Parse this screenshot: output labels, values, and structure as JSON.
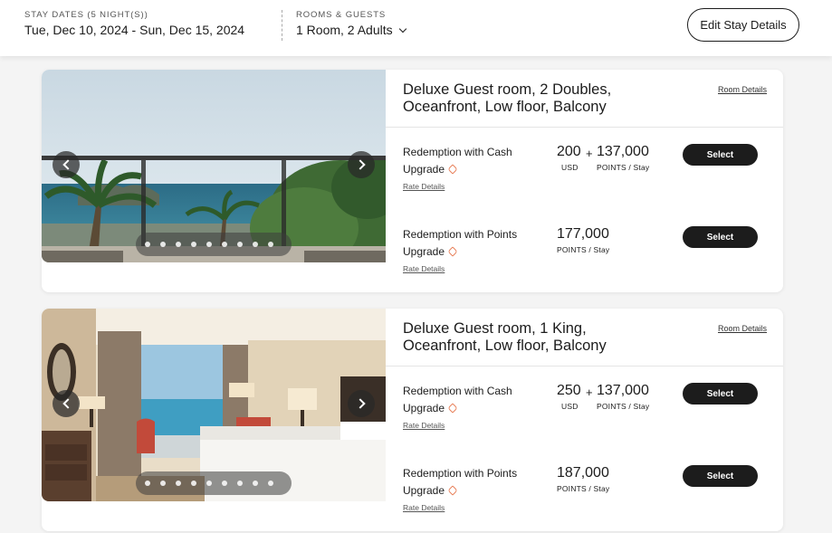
{
  "header": {
    "stay_label": "STAY DATES (5 NIGHT(S))",
    "stay_value": "Tue, Dec 10, 2024 - Sun, Dec 15, 2024",
    "rooms_label": "ROOMS & GUESTS",
    "rooms_value": "1 Room, 2 Adults",
    "edit_button": "Edit Stay Details"
  },
  "rooms": [
    {
      "title_line1": "Deluxe Guest room, 2 Doubles,",
      "title_line2": "Oceanfront, Low floor, Balcony",
      "details_link": "Room Details",
      "rates": [
        {
          "name": "Redemption with Cash",
          "upgrade": "Upgrade",
          "rate_link": "Rate Details",
          "cash": "200",
          "cash_unit": "USD",
          "plus": "+",
          "points": "137,000",
          "points_unit": "POINTS / Stay",
          "select": "Select"
        },
        {
          "name": "Redemption with Points",
          "upgrade": "Upgrade",
          "rate_link": "Rate Details",
          "points": "177,000",
          "points_unit": "POINTS / Stay",
          "select": "Select"
        }
      ]
    },
    {
      "title_line1": "Deluxe Guest room, 1 King,",
      "title_line2": "Oceanfront, Low floor, Balcony",
      "details_link": "Room Details",
      "rates": [
        {
          "name": "Redemption with Cash",
          "upgrade": "Upgrade",
          "rate_link": "Rate Details",
          "cash": "250",
          "cash_unit": "USD",
          "plus": "+",
          "points": "137,000",
          "points_unit": "POINTS / Stay",
          "select": "Select"
        },
        {
          "name": "Redemption with Points",
          "upgrade": "Upgrade",
          "rate_link": "Rate Details",
          "points": "187,000",
          "points_unit": "POINTS / Stay",
          "select": "Select"
        }
      ]
    }
  ],
  "icons": {
    "dropdown": "chevron-down-icon",
    "upgrade": "tag-icon",
    "carousel_prev": "chevron-left-icon",
    "carousel_next": "chevron-right-icon"
  },
  "colors": {
    "button_dark": "#1c1c1c",
    "upgrade_tag": "#e8825c",
    "page_bg": "#f4f4f4"
  }
}
